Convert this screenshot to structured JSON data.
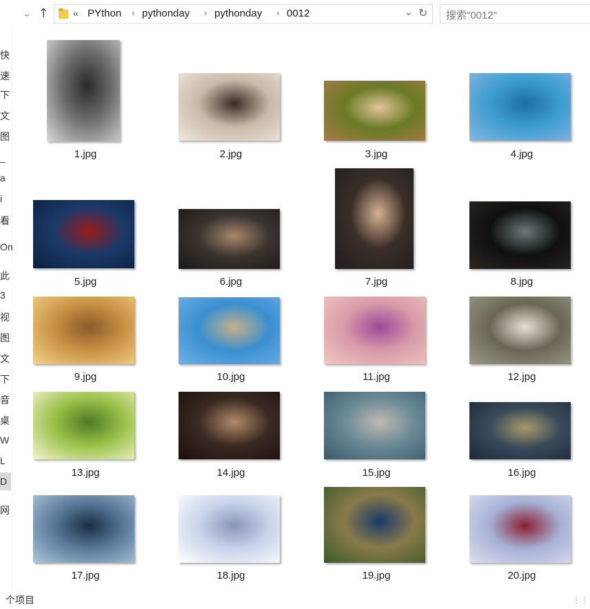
{
  "address": {
    "overflow": "«",
    "crumbs": [
      "PYthon",
      "pythonday",
      "pythonday",
      "0012"
    ]
  },
  "search": {
    "placeholder": "搜索\"0012\""
  },
  "nav_fragments": [
    "快",
    "速",
    "下",
    "文",
    "图",
    "_",
    "a",
    "i",
    "看",
    "On",
    "此",
    "3",
    "视",
    "图",
    "文",
    "下",
    "音",
    "桌",
    "W",
    "L",
    "D",
    "网"
  ],
  "files": [
    {
      "name": "1.jpg",
      "colors": [
        "#d9d9d9",
        "#6e6e6e",
        "#2a2a2a"
      ]
    },
    {
      "name": "2.jpg",
      "colors": [
        "#efe7de",
        "#c9b9a8",
        "#3a2a24"
      ]
    },
    {
      "name": "3.jpg",
      "colors": [
        "#a87a4a",
        "#6a7a24",
        "#e0c49a"
      ]
    },
    {
      "name": "4.jpg",
      "colors": [
        "#86b6e2",
        "#3d9ccf",
        "#1e6fa2"
      ]
    },
    {
      "name": "5.jpg",
      "colors": [
        "#0c1f3a",
        "#1a3a6a",
        "#9b1a1a"
      ]
    },
    {
      "name": "6.jpg",
      "colors": [
        "#1a1816",
        "#3a3430",
        "#a8866a"
      ]
    },
    {
      "name": "7.jpg",
      "colors": [
        "#1e1e1e",
        "#3a2e28",
        "#d6b092"
      ]
    },
    {
      "name": "8.jpg",
      "colors": [
        "#2a2620",
        "#101010",
        "#6a7a78"
      ]
    },
    {
      "name": "9.jpg",
      "colors": [
        "#f4d28a",
        "#c89244",
        "#8a5a2a"
      ]
    },
    {
      "name": "10.jpg",
      "colors": [
        "#6fb0e6",
        "#3a8fd0",
        "#c6b08a"
      ]
    },
    {
      "name": "11.jpg",
      "colors": [
        "#f0c8c0",
        "#d89aa8",
        "#9a4a9a"
      ]
    },
    {
      "name": "12.jpg",
      "colors": [
        "#9a9a88",
        "#6a6656",
        "#e6e0d4"
      ]
    },
    {
      "name": "13.jpg",
      "colors": [
        "#f6f2d0",
        "#9ac24a",
        "#4e7a24"
      ]
    },
    {
      "name": "14.jpg",
      "colors": [
        "#1a0e0e",
        "#3a2a22",
        "#b08a6a"
      ]
    },
    {
      "name": "15.jpg",
      "colors": [
        "#3a5a6a",
        "#6a8a96",
        "#c0b8b0"
      ]
    },
    {
      "name": "16.jpg",
      "colors": [
        "#1a2a3a",
        "#3a4a5a",
        "#a89a6a"
      ]
    },
    {
      "name": "17.jpg",
      "colors": [
        "#aec8da",
        "#5a7a9a",
        "#1a2e44"
      ]
    },
    {
      "name": "18.jpg",
      "colors": [
        "#ffffff",
        "#c8d4ea",
        "#8a96b8"
      ]
    },
    {
      "name": "19.jpg",
      "colors": [
        "#3a5a2a",
        "#8a7a4a",
        "#1a3a6a"
      ]
    },
    {
      "name": "20.jpg",
      "colors": [
        "#dde0f0",
        "#a6b0d6",
        "#8a2030"
      ]
    }
  ],
  "status": {
    "text": "个项目"
  }
}
